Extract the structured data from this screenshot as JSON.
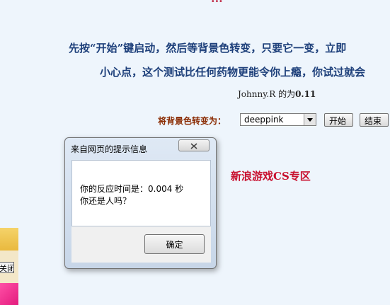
{
  "page": {
    "top_title_fragment": "...",
    "intro_line1": "先按“开始”键启动，然后等背景色转变，只要它一变，立即",
    "intro_line2": "小心点，这个测试比任何药物更能令你上瘾，你试过就会",
    "result_prefix": "Johnny.R 的为",
    "result_value": "0.11",
    "color_label": "将背景色转变为：",
    "color_select_value": "deeppink",
    "start_button": "开始",
    "end_button": "结束",
    "sina_link": "新浪游戏CS专区",
    "left_close_button": "关闭"
  },
  "dialog": {
    "title": "来自网页的提示信息",
    "message_line1": "你的反应时间是：0.004 秒",
    "message_line2": "你还是人吗？",
    "ok_button": "确定"
  },
  "colors": {
    "page_background": "#eef5fc",
    "intro_text": "#1d3f7a",
    "link_red": "#c8102e"
  },
  "icons": {
    "dialog_close": "close-icon",
    "select_arrow": "triangle-down-icon"
  }
}
